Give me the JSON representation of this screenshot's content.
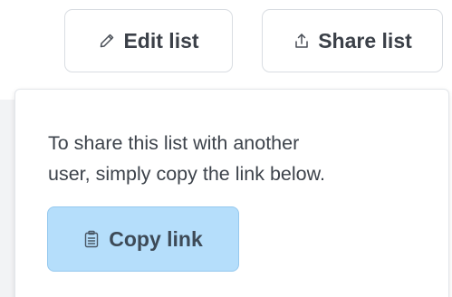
{
  "toolbar": {
    "edit_label": "Edit list",
    "edit_icon": "pencil-icon",
    "share_label": "Share list",
    "share_icon": "share-upload-icon"
  },
  "share_popover": {
    "message_line1": "To share this list with another",
    "message_line2": "user, simply copy the link below.",
    "copy_label": "Copy link",
    "copy_icon": "clipboard-icon"
  },
  "colors": {
    "copy_button_bg": "#b5defb",
    "copy_button_border": "#96c9ee",
    "button_border": "#d9dde2",
    "text": "#3b4048"
  }
}
